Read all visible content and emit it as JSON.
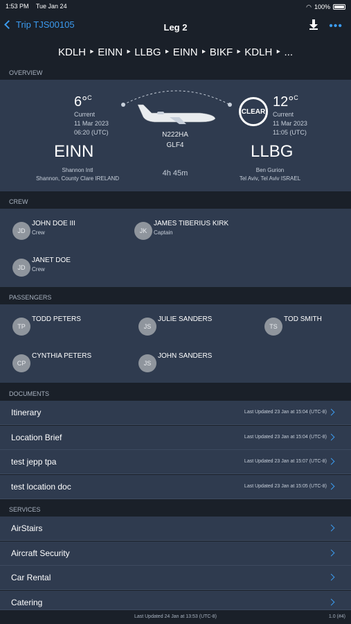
{
  "status": {
    "time": "1:53 PM",
    "date": "Tue Jan 24",
    "battery": "100%"
  },
  "nav": {
    "back_label": "Trip TJS00105",
    "title": "Leg 2",
    "download_icon": "download-icon",
    "more_icon": "more-icon"
  },
  "route": "KDLH ‣ EINN ‣ LLBG ‣ EINN ‣ BIKF ‣ KDLH ‣ ...",
  "sections": {
    "overview": "OVERVIEW",
    "crew": "CREW",
    "passengers": "PASSENGERS",
    "documents": "DOCUMENTS",
    "services": "SERVICES"
  },
  "overview": {
    "departure": {
      "temp": "6°",
      "unit": "C",
      "condition": "Current",
      "date": "11 Mar 2023",
      "time": "06:20 (UTC)",
      "code": "EINN",
      "airport": "Shannon Intl",
      "location": "Shannon, County Clare IRELAND"
    },
    "arrival": {
      "temp": "12°",
      "unit": "C",
      "condition": "Current",
      "date": "11 Mar 2023",
      "time": "11:05 (UTC)",
      "code": "LLBG",
      "airport": "Ben Gurion",
      "location": "Tel Aviv, Tel Aviv ISRAEL",
      "badge": "CLEAR"
    },
    "aircraft": {
      "tail": "N222HA",
      "type": "GLF4",
      "duration": "4h 45m"
    }
  },
  "crew": [
    {
      "initials": "JD",
      "name": "JOHN DOE III",
      "role": "Crew"
    },
    {
      "initials": "JK",
      "name": "JAMES TIBERIUS KIRK",
      "role": "Captain"
    },
    {
      "initials": "JD",
      "name": "JANET DOE",
      "role": "Crew"
    }
  ],
  "passengers": [
    {
      "initials": "TP",
      "name": "TODD PETERS"
    },
    {
      "initials": "JS",
      "name": "JULIE SANDERS"
    },
    {
      "initials": "TS",
      "name": "TOD SMITH"
    },
    {
      "initials": "CP",
      "name": "CYNTHIA PETERS"
    },
    {
      "initials": "JS",
      "name": "JOHN SANDERS"
    }
  ],
  "documents": [
    {
      "label": "Itinerary",
      "meta": "Last Updated 23 Jan at 15:04 (UTC-8)"
    },
    {
      "label": "Location Brief",
      "meta": "Last Updated 23 Jan at 15:04 (UTC-8)"
    },
    {
      "label": "test jepp tpa",
      "meta": "Last Updated 23 Jan at 15:07 (UTC-8)"
    },
    {
      "label": "test location doc",
      "meta": "Last Updated 23 Jan at 15:05 (UTC-8)"
    }
  ],
  "services": [
    {
      "label": "AirStairs"
    },
    {
      "label": "Aircraft Security"
    },
    {
      "label": "Car Rental"
    },
    {
      "label": "Catering"
    }
  ],
  "footer": {
    "updated": "Last Updated 24 Jan at 13:53 (UTC-8)",
    "version": "1.0 (#4)"
  },
  "colors": {
    "accent": "#3b9bf0",
    "panel": "#2f3b4f",
    "background": "#1a2029"
  }
}
